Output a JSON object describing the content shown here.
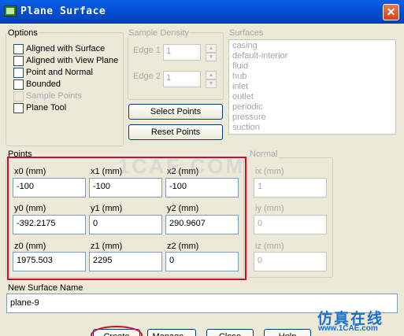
{
  "window": {
    "title": "Plane Surface",
    "close_glyph": "✕"
  },
  "options": {
    "label": "Options",
    "items": [
      {
        "label": "Aligned with Surface",
        "enabled": true
      },
      {
        "label": "Aligned with View Plane",
        "enabled": true
      },
      {
        "label": "Point and Normal",
        "enabled": true
      },
      {
        "label": "Bounded",
        "enabled": true
      },
      {
        "label": "Sample Points",
        "enabled": false
      },
      {
        "label": "Plane Tool",
        "enabled": true
      }
    ]
  },
  "sample_density": {
    "label": "Sample Density",
    "edge1_label": "Edge 1",
    "edge1_value": "1",
    "edge2_label": "Edge 2",
    "edge2_value": "1"
  },
  "buttons": {
    "select_points": "Select Points",
    "reset_points": "Reset Points"
  },
  "surfaces": {
    "label": "Surfaces",
    "items": [
      "casing",
      "default-interior",
      "fluid",
      "hub",
      "inlet",
      "outlet",
      "periodic",
      "pressure",
      "suction"
    ]
  },
  "points": {
    "label": "Points",
    "x0_label": "x0 (mm)",
    "x0": "-100",
    "x1_label": "x1 (mm)",
    "x1": "-100",
    "x2_label": "x2 (mm)",
    "x2": "-100",
    "y0_label": "y0 (mm)",
    "y0": "-392.2175",
    "y1_label": "y1 (mm)",
    "y1": "0",
    "y2_label": "y2 (mm)",
    "y2": "290.9607",
    "z0_label": "z0 (mm)",
    "z0": "1975.503",
    "z1_label": "z1 (mm)",
    "z1": "2295",
    "z2_label": "z2 (mm)",
    "z2": "0"
  },
  "normal": {
    "label": "Normal",
    "ix_label": "ix (mm)",
    "ix": "1",
    "iy_label": "iy (mm)",
    "iy": "0",
    "iz_label": "iz (mm)",
    "iz": "0"
  },
  "new_surface": {
    "label": "New Surface Name",
    "value": "plane-9"
  },
  "footer": {
    "create": "Create",
    "manage": "Manage...",
    "close": "Close",
    "help": "Help"
  },
  "watermark": {
    "line1": "仿真在线",
    "line2": "www.1CAE.com",
    "faint": "1CAE.COM"
  },
  "colors": {
    "annotation_red": "#c8102e",
    "title_blue": "#0551d6",
    "watermark_blue": "#1a6fcf"
  }
}
